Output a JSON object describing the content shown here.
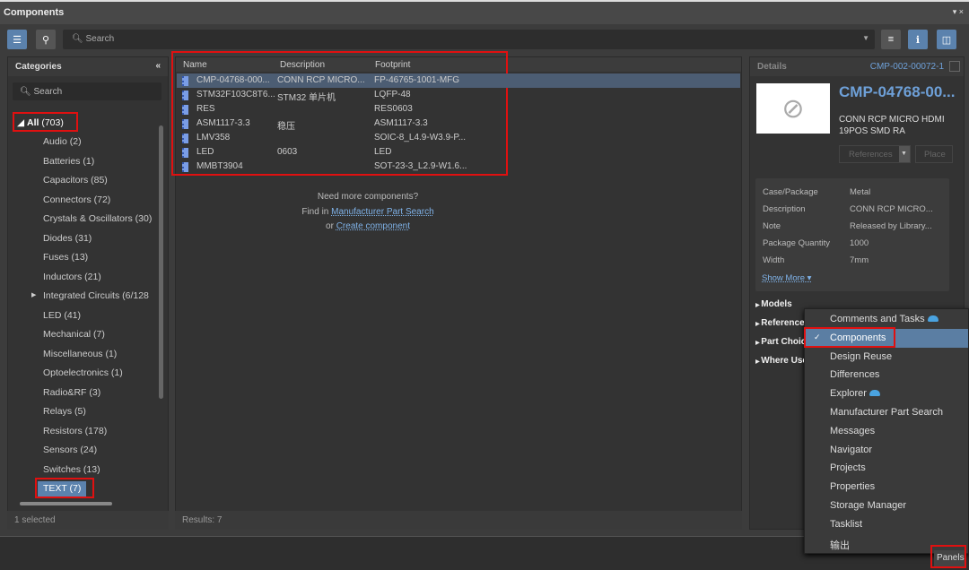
{
  "window": {
    "title": "Components",
    "controls": "▾ ×"
  },
  "toolbar": {
    "search_placeholder": "Search"
  },
  "categories": {
    "title": "Categories",
    "search_placeholder": "Search",
    "all_label": "All",
    "all_count": "(703)",
    "items": [
      "Audio  (2)",
      "Batteries  (1)",
      "Capacitors  (85)",
      "Connectors  (72)",
      "Crystals & Oscillators  (30)",
      "Diodes  (31)",
      "Fuses  (13)",
      "Inductors  (21)",
      "Integrated Circuits  (6/128",
      "LED  (41)",
      "Mechanical  (7)",
      "Miscellaneous  (1)",
      "Optoelectronics  (1)",
      "Radio&RF  (3)",
      "Relays  (5)",
      "Resistors  (178)",
      "Sensors  (24)",
      "Switches  (13)",
      "TEXT  (7)"
    ],
    "status": "1 selected"
  },
  "table": {
    "columns": [
      "Name",
      "Description",
      "Footprint"
    ],
    "rows": [
      [
        "CMP-04768-000...",
        "CONN RCP MICRO...",
        "FP-46765-1001-MFG"
      ],
      [
        "STM32F103C8T6...",
        "STM32 单片机",
        "LQFP-48"
      ],
      [
        "RES",
        "",
        "RES0603"
      ],
      [
        "ASM1117-3.3",
        "稳压",
        "ASM1117-3.3"
      ],
      [
        "LMV358",
        "",
        "SOIC-8_L4.9-W3.9-P..."
      ],
      [
        "LED",
        "0603",
        "LED"
      ],
      [
        "MMBT3904",
        "",
        "SOT-23-3_L2.9-W1.6..."
      ]
    ],
    "more_text": "Need more components?",
    "find_in": "Find in",
    "mps_link": "Manufacturer Part Search",
    "or": "or",
    "create_link": "Create component",
    "results": "Results: 7"
  },
  "details": {
    "title": "Details",
    "id": "CMP-002-00072-1",
    "name": "CMP-04768-00...",
    "description": "CONN RCP MICRO HDMI 19POS SMD RA",
    "references_btn": "References",
    "place_btn": "Place",
    "params": [
      [
        "Case/Package",
        "Metal"
      ],
      [
        "Description",
        "CONN RCP MICRO..."
      ],
      [
        "Note",
        "Released by Library..."
      ],
      [
        "Package Quantity",
        "1000"
      ],
      [
        "Width",
        "7mm"
      ]
    ],
    "show_more": "Show More ▾",
    "sections": [
      "Models",
      "References",
      "Part Choices",
      "Where Used"
    ]
  },
  "menu": {
    "items": [
      {
        "label": "Comments and Tasks",
        "cloud": true
      },
      {
        "label": "Components",
        "checked": true
      },
      {
        "label": "Design Reuse"
      },
      {
        "label": "Differences"
      },
      {
        "label": "Explorer",
        "cloud": true
      },
      {
        "label": "Manufacturer Part Search"
      },
      {
        "label": "Messages"
      },
      {
        "label": "Navigator"
      },
      {
        "label": "Projects"
      },
      {
        "label": "Properties"
      },
      {
        "label": "Storage Manager"
      },
      {
        "label": "Tasklist"
      },
      {
        "label": "输出"
      }
    ]
  },
  "panels_btn": "Panels",
  "colors": {
    "accent": "#5b82ad",
    "highlight": "#e01010",
    "link": "#7fb2e8"
  }
}
